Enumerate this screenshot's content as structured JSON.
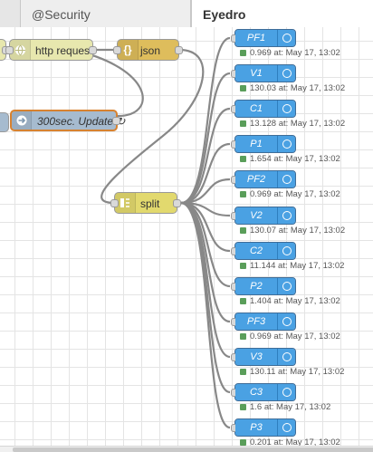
{
  "tabs": [
    {
      "label": "@Security",
      "active": false
    },
    {
      "label": "Eyedro",
      "active": true
    }
  ],
  "nodes": {
    "http_request": {
      "label": "http request",
      "icon": "globe-icon",
      "color": "#e7e7ae"
    },
    "json": {
      "label": "json",
      "icon": "braces-icon",
      "color": "#debd5c"
    },
    "inject": {
      "label": "300sec. Update ↻",
      "icon": "arrow-right-icon",
      "color": "#a6bbcf"
    },
    "split": {
      "label": "split",
      "icon": "split-icon",
      "color": "#e2d96e"
    }
  },
  "debug_nodes": [
    {
      "label": "PF1",
      "status": "0.969 at: May 17, 13:02"
    },
    {
      "label": "V1",
      "status": "130.03 at: May 17, 13:02"
    },
    {
      "label": "C1",
      "status": "13.128 at: May 17, 13:02"
    },
    {
      "label": "P1",
      "status": "1.654 at: May 17, 13:02"
    },
    {
      "label": "PF2",
      "status": "0.969 at: May 17, 13:02"
    },
    {
      "label": "V2",
      "status": "130.07 at: May 17, 13:02"
    },
    {
      "label": "C2",
      "status": "11.144 at: May 17, 13:02"
    },
    {
      "label": "P2",
      "status": "1.404 at: May 17, 13:02"
    },
    {
      "label": "PF3",
      "status": "0.969 at: May 17, 13:02"
    },
    {
      "label": "V3",
      "status": "130.11 at: May 17, 13:02"
    },
    {
      "label": "C3",
      "status": "1.6 at: May 17, 13:02"
    },
    {
      "label": "P3",
      "status": "0.201 at: May 17, 13:02"
    }
  ],
  "colors": {
    "debug_node": "#4aa1e3",
    "status_ok": "#5a9e5a",
    "wire": "#888888"
  }
}
